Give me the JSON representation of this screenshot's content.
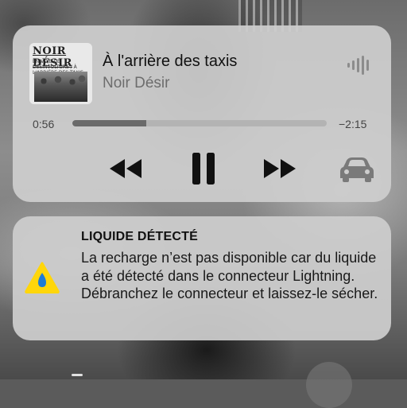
{
  "now_playing": {
    "artwork": {
      "title_text": "NOIR DÉSIR",
      "subtitle_text": "EN VOIE DE DÉSINVOLTURE / À L'ARRIÈRE DES TAXIS"
    },
    "track_title": "À l'arrière des taxis",
    "artist": "Noir Désir",
    "elapsed": "0:56",
    "remaining": "−2:15",
    "progress_fraction": 0.29,
    "controls": {
      "rewind_icon": "rewind-icon",
      "pause_icon": "pause-icon",
      "forward_icon": "fast-forward-icon",
      "output_icon": "car-icon",
      "audio_icon": "audio-waveform-icon"
    }
  },
  "alert": {
    "icon": "liquid-drop-warning-icon",
    "title": "LIQUIDE DÉTECTÉ",
    "body": "La recharge n’est pas disponible car du liquide a été détecté dans le connecteur Lightning. Débranchez le connecteur et laissez-le sécher."
  },
  "colors": {
    "card_bg": "#cdcdcd",
    "progress_fill": "#6a6a6a",
    "alert_triangle": "#ffd60a",
    "alert_drop": "#1e7bd6"
  }
}
